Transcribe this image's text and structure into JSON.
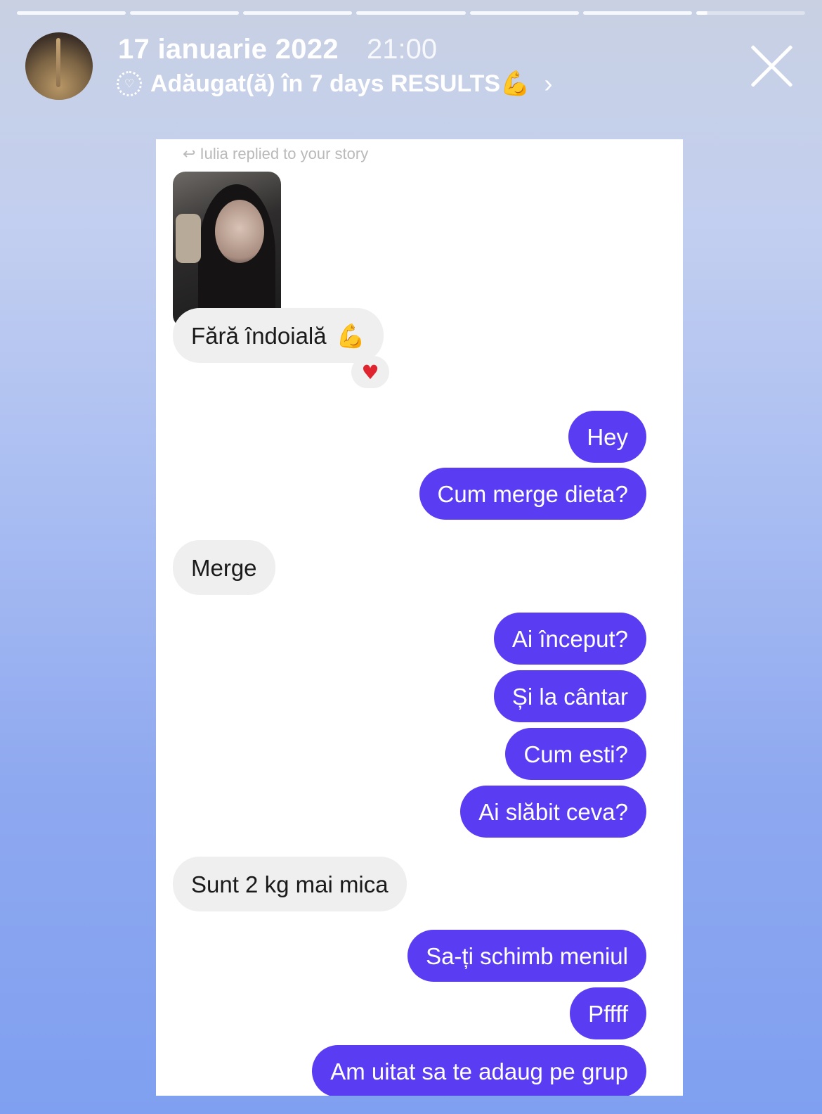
{
  "story": {
    "date": "17 ianuarie 2022",
    "time": "21:00",
    "highlight_prefix": "Adăugat(ă) în 7 days RESULTS",
    "highlight_emoji": "💪",
    "chevron": "›",
    "segments_total": 7
  },
  "chat": {
    "reply_note": "Iulia replied to your story",
    "reaction_emoji": "♥",
    "messages": [
      {
        "side": "in",
        "text": "Fără îndoială",
        "emoji": "💪"
      },
      {
        "side": "out",
        "text": "Hey"
      },
      {
        "side": "out",
        "text": "Cum merge dieta?"
      },
      {
        "side": "in",
        "text": "Merge"
      },
      {
        "side": "out",
        "text": "Ai început?"
      },
      {
        "side": "out",
        "text": "Și la cântar"
      },
      {
        "side": "out",
        "text": "Cum esti?"
      },
      {
        "side": "out",
        "text": "Ai slăbit ceva?"
      },
      {
        "side": "in",
        "text": "Sunt 2 kg mai mica"
      },
      {
        "side": "out",
        "text": "Sa-ți schimb meniul"
      },
      {
        "side": "out",
        "text": "Pffff"
      },
      {
        "side": "out",
        "text": "Am uitat sa te adaug pe grup"
      }
    ]
  },
  "colors": {
    "outgoing_bubble": "#5a3cf2",
    "incoming_bubble": "#efefef",
    "reaction_heart": "#e0242f"
  }
}
